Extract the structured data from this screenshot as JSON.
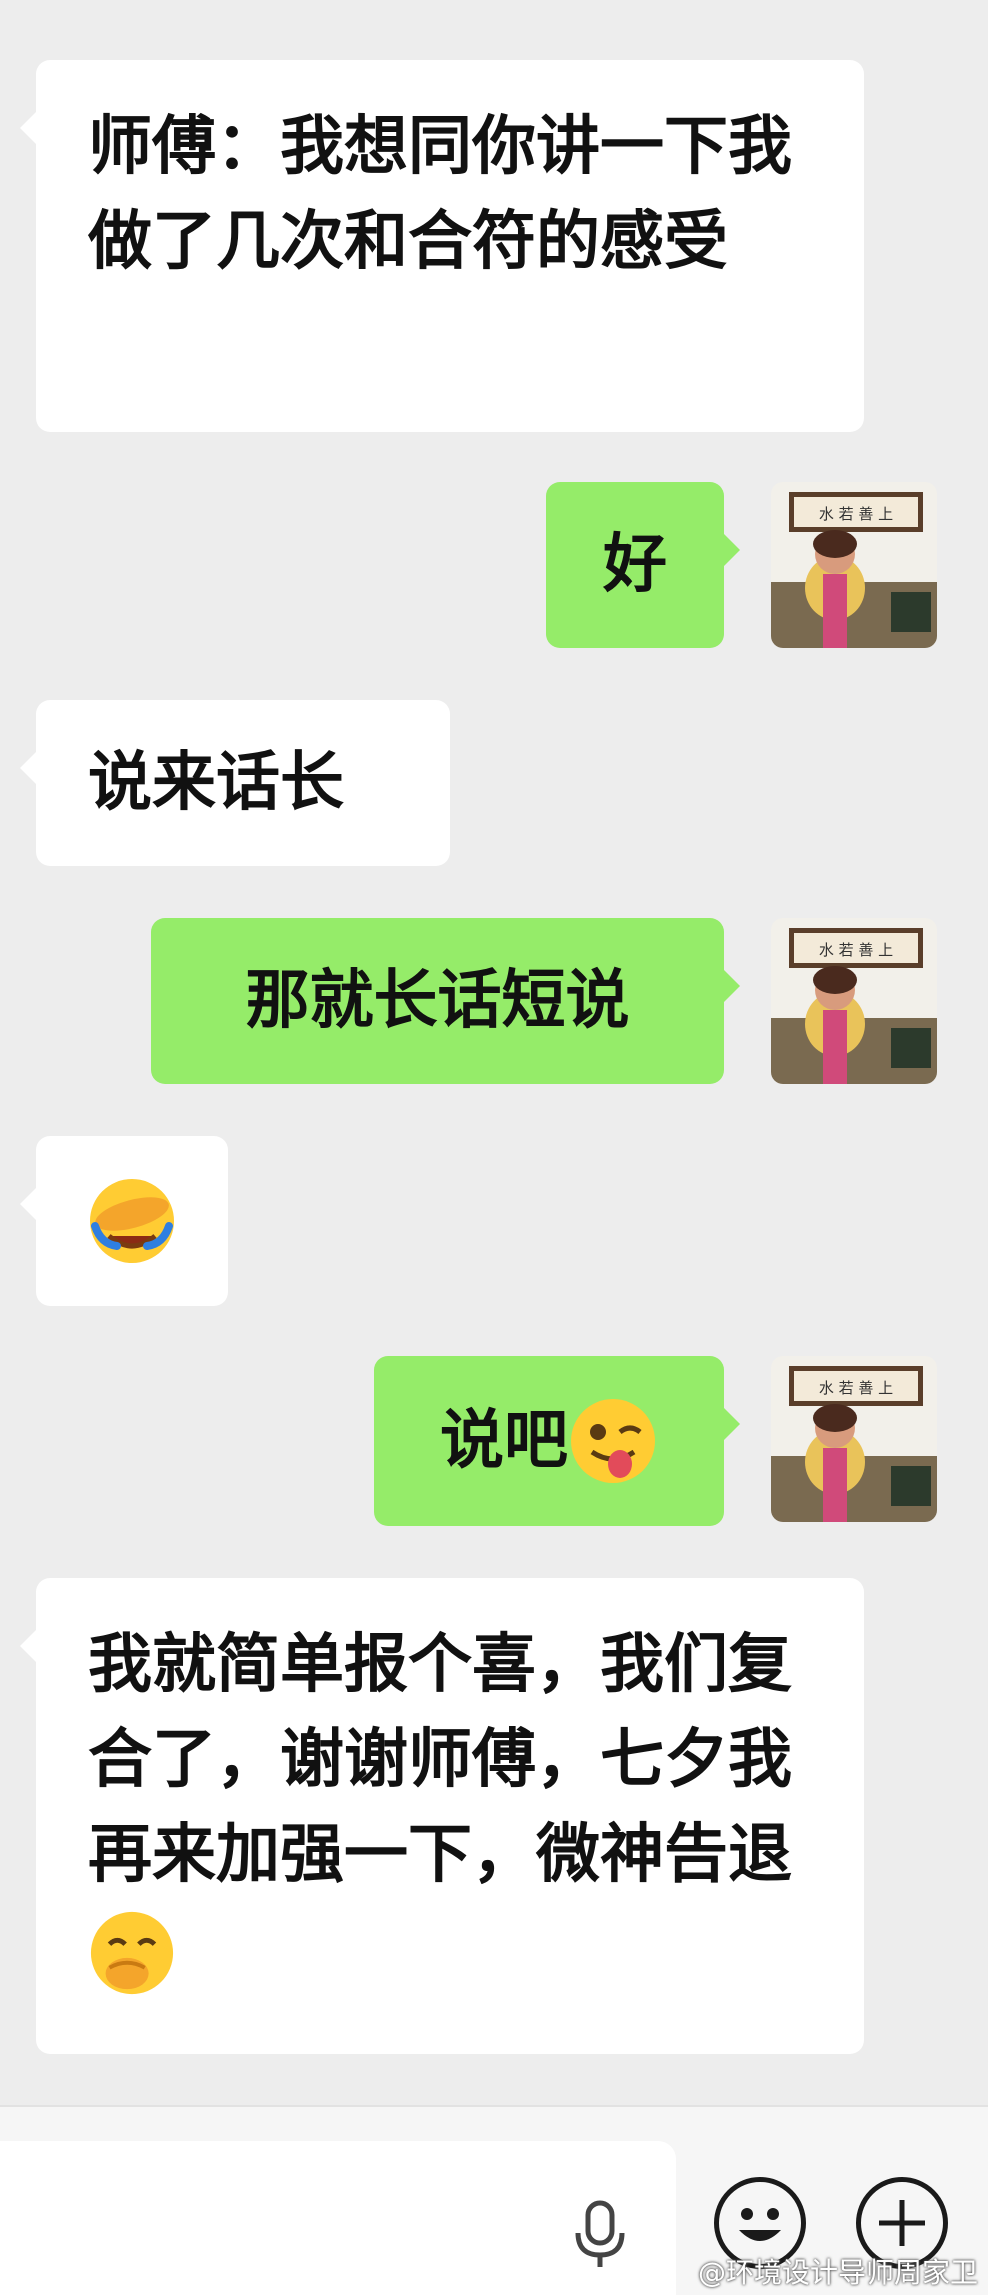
{
  "messages": [
    {
      "side": "in",
      "text": "师傅：我想同你讲一下我做了几次和合符的感受"
    },
    {
      "side": "out",
      "text": "好"
    },
    {
      "side": "in",
      "text": "说来话长"
    },
    {
      "side": "out",
      "text": "那就长话短说"
    },
    {
      "side": "in",
      "emoji": "face-hand-over-eyes-laughing"
    },
    {
      "side": "out",
      "text": "说吧",
      "emoji": "winking-face-with-tongue"
    },
    {
      "side": "in",
      "text": "我就简单报个喜，我们复合了，谢谢师傅，七夕我再来加强一下，微神告退",
      "emoji": "face-with-hand-over-mouth"
    }
  ],
  "avatar": {
    "icon": "user-avatar-photo",
    "sign_text": "水 若 善 上"
  },
  "input_bar": {
    "value": "",
    "icons": [
      "microphone-icon",
      "emoji-icon",
      "plus-icon"
    ]
  },
  "watermark": "@环境设计导师周家卫",
  "colors": {
    "background": "#ededed",
    "incoming": "#ffffff",
    "outgoing": "#95ec69"
  }
}
